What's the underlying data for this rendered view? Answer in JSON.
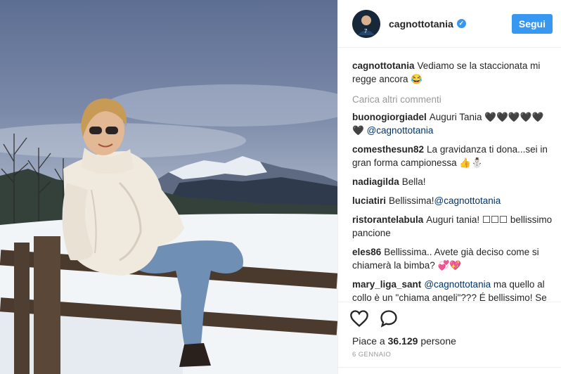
{
  "header": {
    "username": "cagnottotania",
    "follow_label": "Segui"
  },
  "caption": {
    "user": "cagnottotania",
    "text": "Vediamo se la staccionata mi regge ancora 😂"
  },
  "load_more_label": "Carica altri commenti",
  "comments": [
    {
      "user": "buonogiorgiadel",
      "text": "Auguri Tania 🖤🖤🖤🖤🖤🖤",
      "mention": "@cagnottotania",
      "text_after": ""
    },
    {
      "user": "comesthesun82",
      "text": "La gravidanza ti dona...sei in gran forma campionessa 👍⛄",
      "mention": "",
      "text_after": ""
    },
    {
      "user": "nadiagilda",
      "text": "Bella!",
      "mention": "",
      "text_after": ""
    },
    {
      "user": "luciatiri",
      "text": "Bellissima!",
      "mention": "@cagnottotania",
      "text_after": ""
    },
    {
      "user": "ristorantelabula",
      "text": "Auguri tania! ☐☐☐ bellissimo pancione",
      "mention": "",
      "text_after": ""
    },
    {
      "user": "eles86",
      "text": "Bellissima.. Avete già deciso come si chiamerà la bimba? 💞💖",
      "mention": "",
      "text_after": ""
    },
    {
      "user": "mary_liga_sant",
      "text": "",
      "mention": "@cagnottotania",
      "text_after": " ma quello al collo è un \"chiama angeli\"??? É bellissimo! Se lo agiti il bimbo dalla pancia lo sente e ti \"risponde\", ne ho avuto"
    }
  ],
  "likes": {
    "label": "Piace a",
    "count": "36.129",
    "suffix": "persone"
  },
  "date": "6 GENNAIO",
  "icons": {
    "like": "heart-icon",
    "comment": "comment-bubble-icon",
    "verified": "verified-badge-icon"
  },
  "colors": {
    "accent": "#3897f0",
    "mention": "#003569",
    "muted": "#999999"
  }
}
